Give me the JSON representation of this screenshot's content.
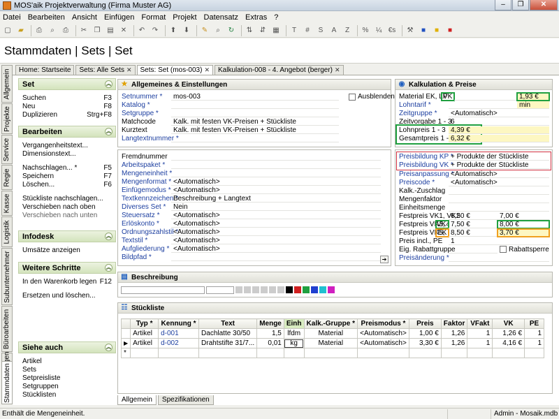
{
  "window": {
    "title": "MOS'aik Projektverwaltung (Firma Muster AG)"
  },
  "menu": [
    "Datei",
    "Bearbeiten",
    "Ansicht",
    "Einfügen",
    "Format",
    "Projekt",
    "Datensatz",
    "Extras",
    "?"
  ],
  "toolbar": {
    "letters": [
      "T",
      "#",
      "S",
      "A",
      "Z",
      "%",
      "¼",
      "€s"
    ]
  },
  "page": {
    "title": "Stammdaten | Sets | Set"
  },
  "doc_tabs": [
    "Home: Startseite",
    "Sets: Alle Sets",
    "Sets: Set (mos-003)",
    "Kalkulation-008 - 4. Angebot (berger)"
  ],
  "vtabs": [
    "Allgemein",
    "Projekte",
    "Service",
    "Regie",
    "Kasse",
    "Logistik",
    "Subunternehmer",
    "Büroarbeiten",
    "Auswertungen",
    "Stammdaten"
  ],
  "sidebar": {
    "set": {
      "title": "Set",
      "items": [
        {
          "label": "Suchen",
          "key": "F3"
        },
        {
          "label": "Neu",
          "key": "F8"
        },
        {
          "label": "Duplizieren",
          "key": "Strg+F8"
        }
      ]
    },
    "bearbeiten": {
      "title": "Bearbeiten",
      "items1": [
        {
          "label": "Vergangenheitstext...",
          "key": ""
        },
        {
          "label": "Dimensionstext...",
          "key": ""
        }
      ],
      "items2": [
        {
          "label": "Nachschlagen... *",
          "key": "F5"
        },
        {
          "label": "Speichern",
          "key": "F7"
        },
        {
          "label": "Löschen...",
          "key": "F6"
        }
      ],
      "items3": [
        {
          "label": "Stückliste nachschlagen...",
          "key": ""
        },
        {
          "label": "Verschieben nach oben",
          "key": ""
        },
        {
          "label": "Verschieben nach unten",
          "key": ""
        }
      ]
    },
    "infodesk": {
      "title": "Infodesk",
      "items": [
        {
          "label": "Umsätze anzeigen",
          "key": ""
        }
      ]
    },
    "weitere": {
      "title": "Weitere Schritte",
      "items1": [
        {
          "label": "In den Warenkorb legen",
          "key": "F12"
        }
      ],
      "items2": [
        {
          "label": "Ersetzen und löschen...",
          "key": ""
        }
      ]
    },
    "siehe": {
      "title": "Siehe auch",
      "items": [
        {
          "label": "Artikel"
        },
        {
          "label": "Sets"
        },
        {
          "label": "Setpreisliste"
        },
        {
          "label": "Setgruppen"
        },
        {
          "label": "Stücklisten"
        }
      ]
    }
  },
  "allg": {
    "title": "Allgemeines & Einstellungen",
    "ausblenden": "Ausblenden",
    "rows1": [
      {
        "label": "Setnummer *",
        "value": "mos-003",
        "link": true
      },
      {
        "label": "Katalog *",
        "value": "",
        "link": true
      },
      {
        "label": "Setgruppe *",
        "value": "",
        "link": true
      },
      {
        "label": "Matchcode",
        "value": "Kalk. mit festen VK-Preisen + Stückliste",
        "link": false
      },
      {
        "label": "Kurztext",
        "value": "Kalk. mit festen VK-Preisen + Stückliste",
        "link": false
      },
      {
        "label": "Langtextnummer *",
        "value": "",
        "link": true
      }
    ],
    "rows2": [
      {
        "label": "Fremdnummer",
        "value": "",
        "link": false
      },
      {
        "label": "Arbeitspaket *",
        "value": "",
        "link": true
      },
      {
        "label": "Mengeneinheit *",
        "value": "",
        "link": true
      },
      {
        "label": "Mengenformat *",
        "value": "<Automatisch>",
        "link": true
      },
      {
        "label": "Einfügemodus *",
        "value": "<Automatisch>",
        "link": true
      },
      {
        "label": "Textkennzeichen *",
        "value": "Beschreibung + Langtext",
        "link": true
      },
      {
        "label": "Diverses Set *",
        "value": "Nein",
        "link": true
      },
      {
        "label": "Steuersatz *",
        "value": "<Automatisch>",
        "link": true
      },
      {
        "label": "Erlöskonto *",
        "value": "<Automatisch>",
        "link": true
      },
      {
        "label": "Ordnungszahlstil *",
        "value": "<Automatisch>",
        "link": true
      },
      {
        "label": "Textstil *",
        "value": "<Automatisch>",
        "link": true
      },
      {
        "label": "Aufgliederung *",
        "value": "<Automatisch>",
        "link": true
      },
      {
        "label": "Bildpfad *",
        "value": "",
        "link": true
      }
    ],
    "arrow": "➔"
  },
  "kalk": {
    "title": "Kalkulation & Preise",
    "material": {
      "label": "Material EK, LP",
      "mid": "VK",
      "value": "1,93 €"
    },
    "lohntarif": {
      "label": "Lohntarif *",
      "value": "min"
    },
    "zeitgruppe": {
      "label": "Zeitgruppe *",
      "value": "<Automatisch>"
    },
    "zeitvorgabe": {
      "label": "Zeitvorgabe 1 - 3",
      "value": "6"
    },
    "lohnpreis": {
      "label": "Lohnpreis 1 - 3",
      "value": "4,39 €"
    },
    "gesamtpreis": {
      "label": "Gesamtpreis 1 - 3",
      "value": "6,32 €"
    },
    "pbkp": {
      "label": "Preisbildung KP *",
      "value": "+ Produkte der Stückliste"
    },
    "pbvk": {
      "label": "Preisbildung VK *",
      "value": "+ Produkte der Stückliste"
    },
    "preisanpassung": {
      "label": "Preisanpassung *",
      "value": "<Automatisch>"
    },
    "preiscode": {
      "label": "Preiscode *",
      "value": "<Automatisch>"
    },
    "kalkzuschlag": {
      "label": "Kalk.-Zuschlag"
    },
    "mengenfaktor": {
      "label": "Mengenfaktor"
    },
    "einheitsmenge": {
      "label": "Einheitsmenge"
    },
    "fp1": {
      "label": "Festpreis VK1, VK2",
      "v1": "6,50 €",
      "v2": "7,00 €"
    },
    "fp3": {
      "label": "Festpreis VK3,",
      "tag": "VK4",
      "v1": "7,50 €",
      "v2": "8,00 €"
    },
    "fp5": {
      "label": "Festpreis VK5,",
      "tag": "EK",
      "v1": "8,50 €",
      "v2": "3,70 €"
    },
    "preisincl": {
      "label": "Preis incl., PE",
      "value": "1"
    },
    "rabattgruppe": {
      "label": "Eig. Rabattgruppe",
      "chk": "Rabattsperre"
    },
    "preisaenderung": {
      "label": "Preisänderung *"
    }
  },
  "beschreibung": {
    "title": "Beschreibung"
  },
  "stueckliste": {
    "title": "Stückliste",
    "headers": [
      "Typ *",
      "Kennung *",
      "Text",
      "Menge",
      "Einh",
      "Kalk.-Gruppe *",
      "Preismodus *",
      "Preis",
      "Faktor",
      "VFakt",
      "VK",
      "PE"
    ],
    "rows": [
      [
        "Artikel",
        "d-001",
        "Dachlatte 30/50",
        "1,5",
        "lfdm",
        "Material",
        "<Automatisch>",
        "1,00 €",
        "1,26",
        "1",
        "1,26 €",
        "1"
      ],
      [
        "Artikel",
        "d-002",
        "Drahtstifte 31/7...",
        "0,01",
        "kg",
        "Material",
        "<Automatisch>",
        "3,30 €",
        "1,26",
        "1",
        "4,16 €",
        "1"
      ]
    ],
    "newrow": "*"
  },
  "bottom_tabs": [
    "Allgemein",
    "Spezifikationen"
  ],
  "status": {
    "text": "Enthält die Mengeneinheit.",
    "user": "Admin - Mosaik.mdb"
  },
  "colors": {
    "accent_green": "#20a040",
    "accent_orange": "#f0a020",
    "accent_red": "#d03040",
    "highlight": "#fdf7c2",
    "link": "#1d3fa0"
  }
}
